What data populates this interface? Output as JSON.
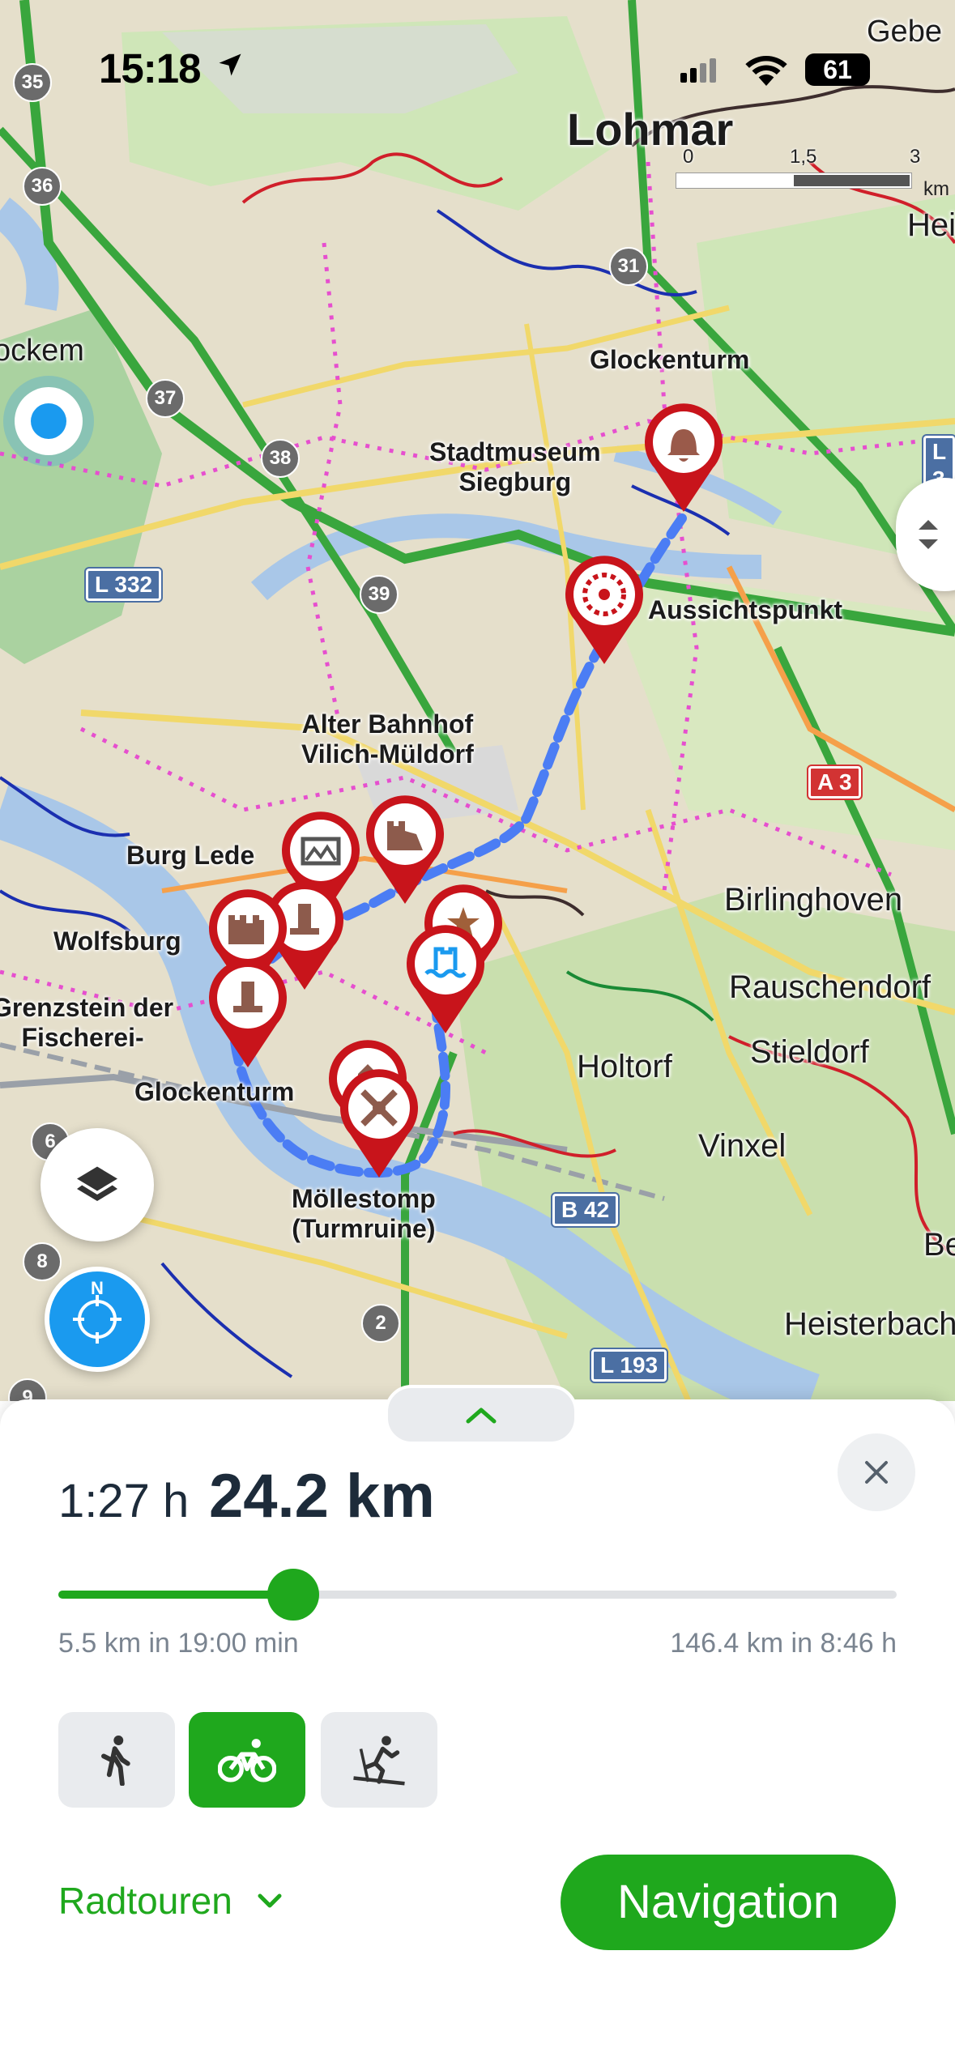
{
  "status_bar": {
    "time": "15:18",
    "battery": "61"
  },
  "map": {
    "places": {
      "lohmar": "Lohmar",
      "gebe": "Gebe",
      "hei": "Hei",
      "ckem": "ockem",
      "glockenturm_top": "Glockenturm",
      "stadtmuseum": "Stadtmuseum\nSiegburg",
      "aussichtspunkt": "Aussichtspunkt",
      "alter_bahnhof": "Alter Bahnhof\nVilich-Müldorf",
      "burg_lede": "Burg Lede",
      "wolfsburg": "Wolfsburg",
      "grenzstein": "Grenzstein der\nFischerei-",
      "glockenturm_bottom": "Glockenturm",
      "moellestomp": "Möllestomp\n(Turmruine)",
      "birlinghoven": "Birlinghoven",
      "rauschendorf": "Rauschendorf",
      "stieldorf": "Stieldorf",
      "holtorf": "Holtorf",
      "vinxel": "Vinxel",
      "heisterbach": "Heisterbach",
      "be": "Be"
    },
    "road_shields": {
      "l332": "L 332",
      "a3": "A 3",
      "b42": "B 42",
      "l193": "L 193",
      "l3": "L 3"
    },
    "route_numbers": [
      "35",
      "36",
      "37",
      "38",
      "39",
      "31",
      "6",
      "8",
      "2",
      "9"
    ],
    "scale": {
      "labels": [
        "0",
        "1,5",
        "3"
      ],
      "unit": "km"
    },
    "compass_label": "N"
  },
  "route_panel": {
    "duration": "1:27 h",
    "distance": "24.2 km",
    "slider": {
      "fraction": 0.28,
      "min_label": "5.5 km in 19:00 min",
      "max_label": "146.4 km in 8:46 h"
    },
    "modes": [
      "walking",
      "cycling",
      "cross-country-skiing"
    ],
    "active_mode": "cycling",
    "category": "Radtouren",
    "navigation_label": "Navigation"
  },
  "colors": {
    "accent": "#1fa81d",
    "poi_red": "#c8141b",
    "locate_blue": "#1a9aef"
  }
}
